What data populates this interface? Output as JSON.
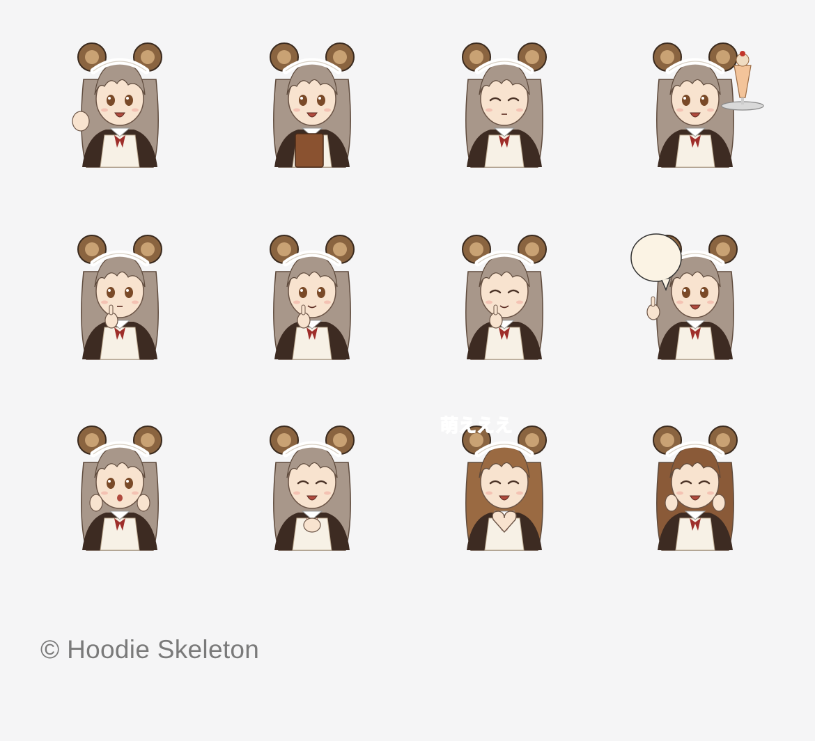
{
  "stickers": [
    {
      "label": "",
      "pose": "wave",
      "eyes": "open",
      "mouth": "open",
      "hair": "#a8978a",
      "prop": "none"
    },
    {
      "label": "",
      "pose": "menu",
      "eyes": "open",
      "mouth": "open",
      "hair": "#a8978a",
      "prop": "menu"
    },
    {
      "label": "",
      "pose": "idle",
      "eyes": "closed",
      "mouth": "small",
      "hair": "#a8978a",
      "prop": "none"
    },
    {
      "label": "",
      "pose": "tray",
      "eyes": "open",
      "mouth": "open",
      "hair": "#a8978a",
      "prop": "parfait"
    },
    {
      "label": "",
      "pose": "shh",
      "eyes": "open",
      "mouth": "small",
      "hair": "#a8978a",
      "prop": "none"
    },
    {
      "label": "",
      "pose": "shh",
      "eyes": "open",
      "mouth": "smile",
      "hair": "#a8978a",
      "prop": "none"
    },
    {
      "label": "",
      "pose": "shh",
      "eyes": "closed",
      "mouth": "smile",
      "hair": "#a8978a",
      "prop": "none"
    },
    {
      "label": "",
      "pose": "point",
      "eyes": "open",
      "mouth": "open",
      "hair": "#a8978a",
      "prop": "bubble"
    },
    {
      "label": "",
      "pose": "surprise",
      "eyes": "open",
      "mouth": "o",
      "hair": "#a8978a",
      "prop": "none"
    },
    {
      "label": "",
      "pose": "clasp",
      "eyes": "closed",
      "mouth": "open",
      "hair": "#a8978a",
      "prop": "none"
    },
    {
      "label": "萌えええ",
      "pose": "heart",
      "eyes": "closed",
      "mouth": "open",
      "hair": "#9a6a42",
      "prop": "none"
    },
    {
      "label": "",
      "pose": "cheeks",
      "eyes": "closed",
      "mouth": "open",
      "hair": "#8a5a38",
      "prop": "none"
    }
  ],
  "footer": {
    "copyright": "© Hoodie Skeleton"
  },
  "colors": {
    "background": "#f5f5f6",
    "footer_text": "#7a7a7a",
    "ear": "#8a6440",
    "dress": "#3d2b22",
    "apron": "#f7f1e6",
    "ribbon": "#9e2e2a"
  }
}
